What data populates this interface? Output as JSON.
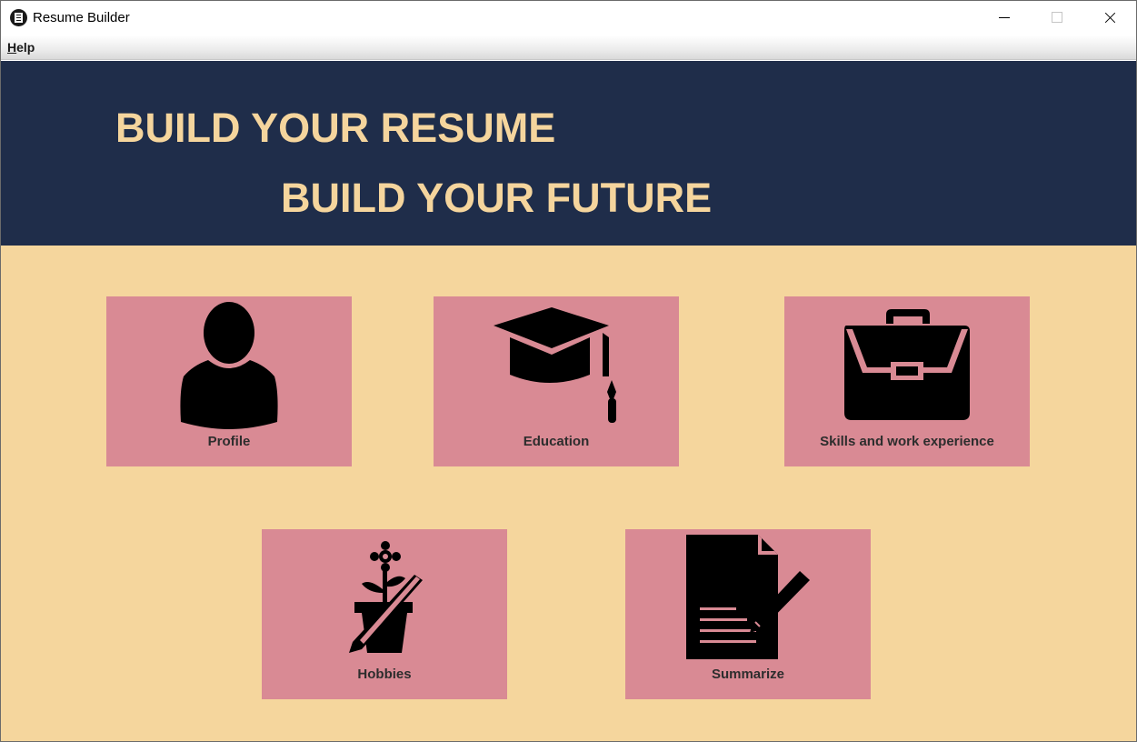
{
  "window": {
    "title": "Resume Builder",
    "icon": "resume-doc-icon"
  },
  "menubar": {
    "help": {
      "mnemonic": "H",
      "rest": "elp"
    }
  },
  "banner": {
    "line1": "BUILD YOUR RESUME",
    "line2": "BUILD YOUR FUTURE"
  },
  "tiles": [
    {
      "label": "Profile",
      "icon": "person-icon"
    },
    {
      "label": "Education",
      "icon": "graduation-cap-icon"
    },
    {
      "label": "Skills and work experience",
      "icon": "briefcase-icon"
    },
    {
      "label": "Hobbies",
      "icon": "flower-pot-icon"
    },
    {
      "label": "Summarize",
      "icon": "document-pencil-icon"
    }
  ],
  "colors": {
    "banner_bg": "#1f2d4a",
    "headline_text": "#f5d59d",
    "content_bg": "#f5d69d",
    "tile_bg": "#d98a94",
    "icon_fill": "#000000"
  }
}
